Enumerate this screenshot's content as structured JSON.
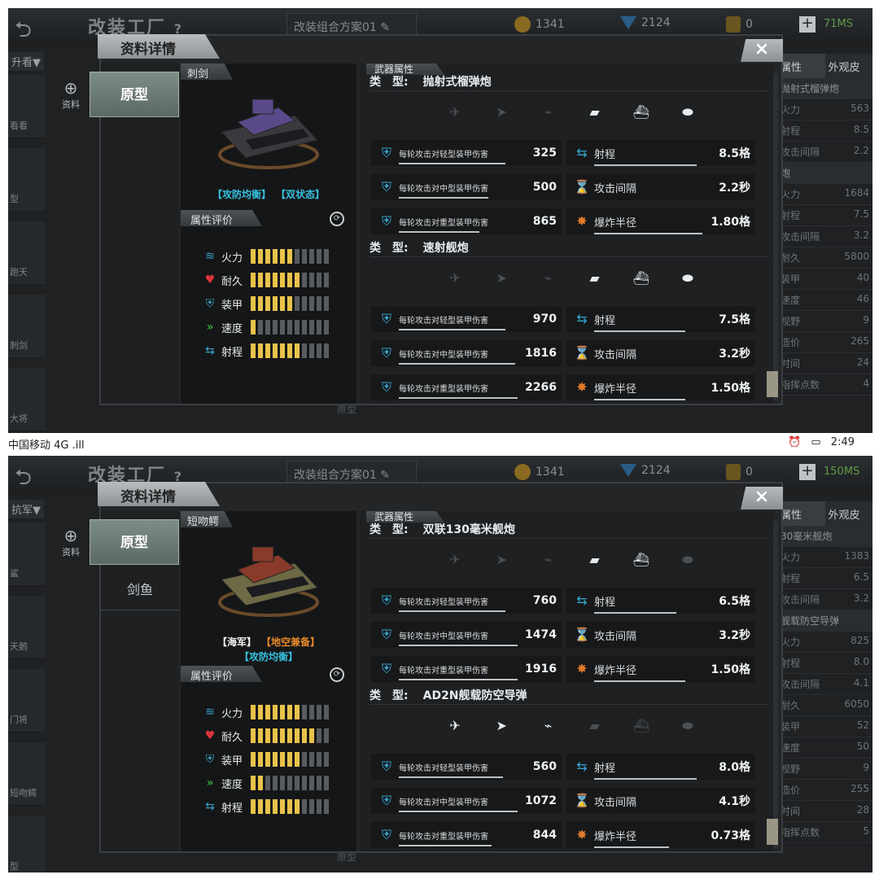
{
  "status_bar": {
    "carrier": "中国移动",
    "signal": "4G .ill",
    "time": "2:49"
  },
  "colors": {
    "accent_green": "#7e8d86",
    "rating_on": "#e8c24a",
    "tag_cyan": "#35c3e0",
    "tag_orange": "#e8882a"
  },
  "screens": [
    {
      "bg": {
        "title": "改装工厂",
        "help": "?",
        "plan": "改装组合方案01",
        "coins": "1341",
        "gems": "2124",
        "badges": "0",
        "ms": "71MS",
        "filter": "升看▼",
        "info_add": "资料",
        "right_tabs": [
          "属性",
          "外观皮"
        ],
        "right_rows": [
          {
            "k": "抛射式榴弹炮",
            "v": "",
            "sub": true
          },
          {
            "k": "火力",
            "v": "563"
          },
          {
            "k": "射程",
            "v": "8.5"
          },
          {
            "k": "攻击间隔",
            "v": "2.2"
          },
          {
            "k": "炮",
            "v": "",
            "sub": true
          },
          {
            "k": "火力",
            "v": "1684"
          },
          {
            "k": "射程",
            "v": "7.5"
          },
          {
            "k": "攻击间隔",
            "v": "3.2"
          },
          {
            "k": "耐久",
            "v": "5800"
          },
          {
            "k": "装甲",
            "v": "40"
          },
          {
            "k": "速度",
            "v": "46"
          },
          {
            "k": "视野",
            "v": "9"
          },
          {
            "k": "造价",
            "v": "265"
          },
          {
            "k": "时间",
            "v": "24"
          },
          {
            "k": "指挥点数",
            "v": "4"
          }
        ],
        "left_items": [
          "看看",
          "型",
          "跑天",
          "刺剑",
          "大将"
        ],
        "bottom_label": "原型"
      },
      "modal": {
        "title": "资料详情",
        "close": "×",
        "tabs": [
          "原型"
        ],
        "ship_name": "刺剑",
        "tags_line1": [
          {
            "text": "【攻防均衡】",
            "color": "#35c3e0"
          },
          {
            "text": "【双状态】",
            "color": "#35c3e0"
          }
        ],
        "tags_line2": [],
        "eval_title": "属性评价",
        "ratings": [
          {
            "label": "火力",
            "icon": "firepower-icon",
            "level": 6
          },
          {
            "label": "耐久",
            "icon": "heart-icon",
            "level": 7
          },
          {
            "label": "装甲",
            "icon": "armor-icon",
            "level": 6
          },
          {
            "label": "速度",
            "icon": "speed-icon",
            "level": 1
          },
          {
            "label": "射程",
            "icon": "range-icon",
            "level": 7
          }
        ],
        "attr_title": "武器属性",
        "weapons": [
          {
            "type_key": "类　型:",
            "type_name": "抛射式榴弹炮",
            "targets": [
              false,
              false,
              false,
              true,
              true,
              true
            ],
            "stats": [
              {
                "label": "每轮攻击对轻型装甲伤害",
                "value": "325",
                "bar": 0.9
              },
              {
                "label": "射程",
                "value": "8.5格",
                "bar": 0.9
              },
              {
                "label": "每轮攻击对中型装甲伤害",
                "value": "500",
                "bar": 0.75
              },
              {
                "label": "攻击间隔",
                "value": "2.2秒",
                "bar": 0.0
              },
              {
                "label": "每轮攻击对重型装甲伤害",
                "value": "865",
                "bar": 0.68
              },
              {
                "label": "爆炸半径",
                "value": "1.80格",
                "bar": 0.95
              }
            ]
          },
          {
            "type_key": "类　型:",
            "type_name": "速射舰炮",
            "targets": [
              false,
              false,
              false,
              true,
              true,
              true
            ],
            "stats": [
              {
                "label": "每轮攻击对轻型装甲伤害",
                "value": "970",
                "bar": 0.9
              },
              {
                "label": "射程",
                "value": "7.5格",
                "bar": 0.8
              },
              {
                "label": "每轮攻击对中型装甲伤害",
                "value": "1816",
                "bar": 0.98
              },
              {
                "label": "攻击间隔",
                "value": "3.2秒",
                "bar": 0.0
              },
              {
                "label": "每轮攻击对重型装甲伤害",
                "value": "2266",
                "bar": 1.0
              },
              {
                "label": "爆炸半径",
                "value": "1.50格",
                "bar": 0.8
              }
            ]
          }
        ]
      }
    },
    {
      "bg": {
        "title": "改装工厂",
        "help": "?",
        "plan": "改装组合方案01",
        "coins": "1341",
        "gems": "2124",
        "badges": "0",
        "ms": "150MS",
        "filter": "抗军▼",
        "info_add": "资料",
        "right_tabs": [
          "属性",
          "外观皮"
        ],
        "right_rows": [
          {
            "k": "30毫米舰炮",
            "v": "",
            "sub": true
          },
          {
            "k": "火力",
            "v": "1383"
          },
          {
            "k": "射程",
            "v": "6.5"
          },
          {
            "k": "攻击间隔",
            "v": "3.2"
          },
          {
            "k": "舰载防空导弹",
            "v": "",
            "sub": true
          },
          {
            "k": "火力",
            "v": "825"
          },
          {
            "k": "射程",
            "v": "8.0"
          },
          {
            "k": "攻击间隔",
            "v": "4.1"
          },
          {
            "k": "耐久",
            "v": "6050"
          },
          {
            "k": "装甲",
            "v": "52"
          },
          {
            "k": "速度",
            "v": "50"
          },
          {
            "k": "视野",
            "v": "9"
          },
          {
            "k": "造价",
            "v": "255"
          },
          {
            "k": "时间",
            "v": "28"
          },
          {
            "k": "指挥点数",
            "v": "5"
          }
        ],
        "left_items": [
          "鲨",
          "天鹅",
          "门将",
          "短吻鳄",
          "型"
        ],
        "bottom_label": "原型"
      },
      "modal": {
        "title": "资料详情",
        "close": "×",
        "tabs": [
          "原型",
          "剑鱼"
        ],
        "ship_name": "短吻鳄",
        "tags_line1": [
          {
            "text": "【海军】",
            "color": "#f2f4f5"
          },
          {
            "text": "【地空兼备】",
            "color": "#e8882a"
          }
        ],
        "tags_line2": [
          {
            "text": "【攻防均衡】",
            "color": "#35c3e0"
          }
        ],
        "eval_title": "属性评价",
        "ratings": [
          {
            "label": "火力",
            "icon": "firepower-icon",
            "level": 7
          },
          {
            "label": "耐久",
            "icon": "heart-icon",
            "level": 9
          },
          {
            "label": "装甲",
            "icon": "armor-icon",
            "level": 7
          },
          {
            "label": "速度",
            "icon": "speed-icon",
            "level": 2
          },
          {
            "label": "射程",
            "icon": "range-icon",
            "level": 7
          }
        ],
        "attr_title": "武器属性",
        "weapons": [
          {
            "type_key": "类　型:",
            "type_name": "双联130毫米舰炮",
            "targets": [
              false,
              false,
              false,
              true,
              true,
              false
            ],
            "stats": [
              {
                "label": "每轮攻击对轻型装甲伤害",
                "value": "760",
                "bar": 0.9
              },
              {
                "label": "射程",
                "value": "6.5格",
                "bar": 0.72
              },
              {
                "label": "每轮攻击对中型装甲伤害",
                "value": "1474",
                "bar": 1.0
              },
              {
                "label": "攻击间隔",
                "value": "3.2秒",
                "bar": 0.0
              },
              {
                "label": "每轮攻击对重型装甲伤害",
                "value": "1916",
                "bar": 1.0
              },
              {
                "label": "爆炸半径",
                "value": "1.50格",
                "bar": 0.8
              }
            ]
          },
          {
            "type_key": "类　型:",
            "type_name": "AD2N舰载防空导弹",
            "targets": [
              true,
              true,
              true,
              false,
              false,
              false
            ],
            "stats": [
              {
                "label": "每轮攻击对轻型装甲伤害",
                "value": "560",
                "bar": 0.88
              },
              {
                "label": "射程",
                "value": "8.0格",
                "bar": 0.9
              },
              {
                "label": "每轮攻击对中型装甲伤害",
                "value": "1072",
                "bar": 1.0
              },
              {
                "label": "攻击间隔",
                "value": "4.1秒",
                "bar": 0.0
              },
              {
                "label": "每轮攻击对重型装甲伤害",
                "value": "844",
                "bar": 0.78
              },
              {
                "label": "爆炸半径",
                "value": "0.73格",
                "bar": 0.66
              }
            ]
          }
        ]
      }
    }
  ]
}
